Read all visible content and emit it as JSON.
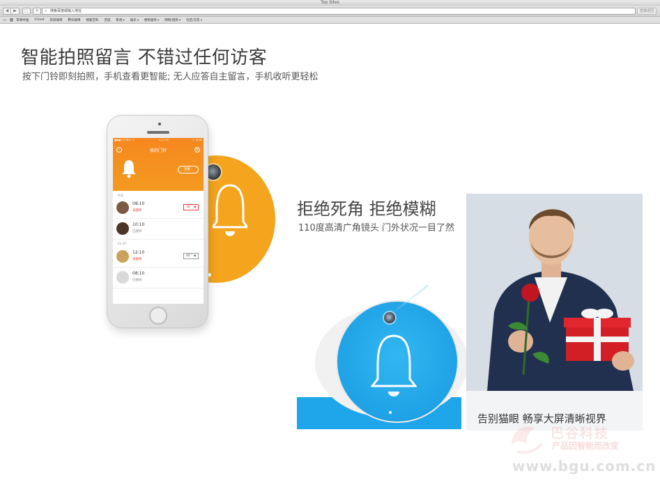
{
  "window": {
    "title": "Top Sites"
  },
  "toolbar": {
    "back_label": "◀",
    "forward_label": "▶",
    "share_label": "⬚",
    "add_label": "+",
    "url_placeholder": "搜索百度或输入地址",
    "right_button_label": "直接返回"
  },
  "bookmarks": {
    "items": [
      {
        "label": "苹果中国",
        "dropdown": false
      },
      {
        "label": "iCloud",
        "dropdown": false
      },
      {
        "label": "新浪微博",
        "dropdown": false
      },
      {
        "label": "腾讯微博",
        "dropdown": false
      },
      {
        "label": "搜狐百科",
        "dropdown": false
      },
      {
        "label": "百度",
        "dropdown": false
      },
      {
        "label": "影视",
        "dropdown": true
      },
      {
        "label": "娱乐",
        "dropdown": true
      },
      {
        "label": "便民服务",
        "dropdown": true
      },
      {
        "label": "网购/团购",
        "dropdown": true
      },
      {
        "label": "社区/交友",
        "dropdown": true
      }
    ]
  },
  "hero": {
    "title": "智能拍照留言 不错过任何访客",
    "subtitle": "按下门铃即刻拍照，手机查看更智能; 无人应答自主留言，手机收听更轻松"
  },
  "phone_app": {
    "status_left": "●●●○○ BELL ✦",
    "status_center": "4:21 PM",
    "status_right": "✦ 100%",
    "screen_title": "我的门铃",
    "view_button": "查看 ›",
    "sections": [
      {
        "day": "今天",
        "records": [
          {
            "time": "08:10",
            "status": "未接听",
            "status_color": "red",
            "duration": "30 ″ ◀",
            "avatar_color": "#7b5a45"
          },
          {
            "time": "10:10",
            "status": "已接听",
            "status_color": "gray",
            "duration": "",
            "avatar_color": "#4d3427"
          }
        ]
      },
      {
        "day": "11-30",
        "records": [
          {
            "time": "12:10",
            "status": "未接听",
            "status_color": "red",
            "duration": "60 ″ ◀",
            "avatar_color": "#caa25a"
          },
          {
            "time": "08:10",
            "status": "已接听",
            "status_color": "gray",
            "duration": "",
            "avatar_color": "#d9d9d9"
          }
        ]
      }
    ]
  },
  "feature": {
    "title": "拒绝死角 拒绝模糊",
    "subtitle": "110度高清广角镜头 门外状况一目了然"
  },
  "photo_card": {
    "caption": "告别猫眼 畅享大屏清晰视界"
  },
  "watermark": {
    "logo": "巴谷科技",
    "tagline": "产品因智能而改变",
    "url": "www.bgu.com.cn"
  },
  "colors": {
    "orange": "#f4a41d",
    "app_orange": "#f6871f",
    "device_blue": "#1ea5ea",
    "alert_red": "#e03c2f"
  }
}
